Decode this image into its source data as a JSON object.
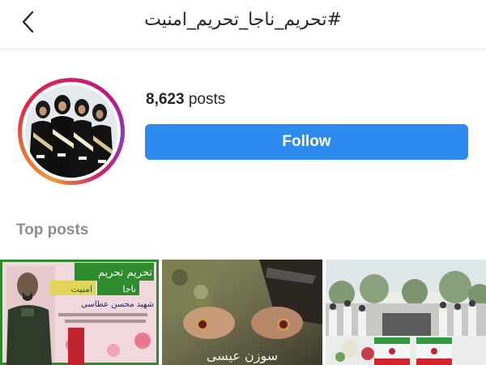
{
  "header": {
    "title": "#تحریم_ناجا_تحریم_امنیت",
    "back_icon": "chevron-left-icon"
  },
  "profile": {
    "posts_count": "8,623",
    "posts_label": "posts",
    "follow_label": "Follow",
    "avatar_ring_colors": [
      "#f09433",
      "#dc2743",
      "#bc1888"
    ]
  },
  "top_posts": {
    "title": "Top posts",
    "items": [
      {
        "overlay_lines": [
          "تحریم تحریم",
          "ناجا",
          "امنیت",
          "شهید محسن عطاسی"
        ]
      },
      {
        "overlay_text": "سوزن عیسی"
      },
      {
        "caption": ""
      }
    ]
  },
  "colors": {
    "follow_button": "#2d8bf0",
    "secondary_text": "#8e8e8e",
    "primary_text": "#262626"
  }
}
